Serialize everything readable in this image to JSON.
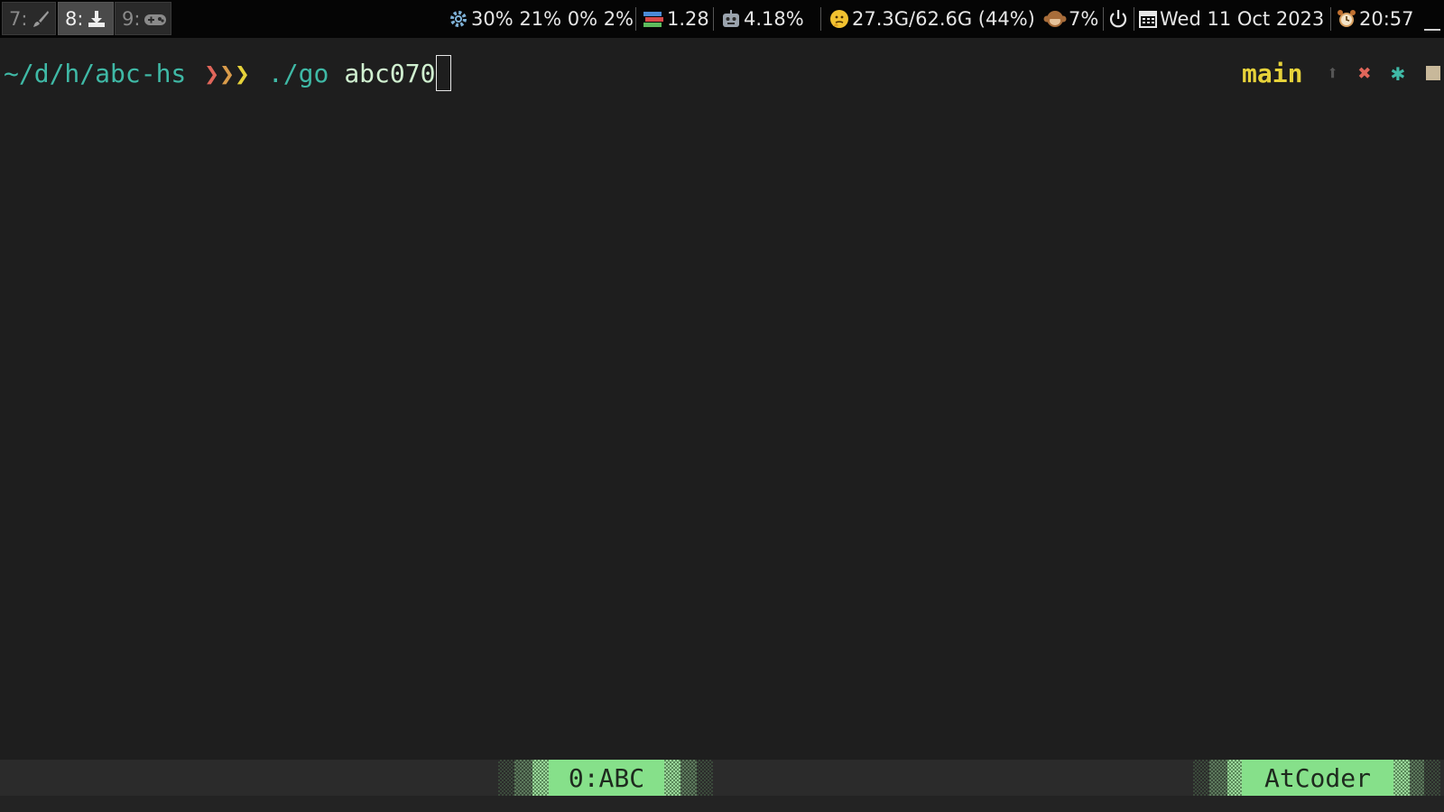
{
  "workspaces": [
    {
      "num": "7:",
      "icon": "paintbrush-icon",
      "active": false
    },
    {
      "num": "8:",
      "icon": "download-icon",
      "active": true
    },
    {
      "num": "9:",
      "icon": "gamepad-icon",
      "active": false
    }
  ],
  "status": {
    "cpu": "30% 21% 0% 2%",
    "load": "1.28",
    "gpu": "4.18%",
    "memory": "27.3G/62.6G (44%)",
    "volume": "7%",
    "date": "Wed 11 Oct 2023",
    "time": "20:57"
  },
  "terminal": {
    "cwd": "~/d/h/abc-hs",
    "arrows": [
      "❯",
      "❯",
      "❯"
    ],
    "command": "./go",
    "argument": "abc070",
    "branch": "main",
    "git_ahead": "⬆",
    "git_deleted": "✖",
    "git_modified": "✱"
  },
  "tmux": {
    "window_label": "0:ABC",
    "session_label": "AtCoder"
  },
  "colors": {
    "cwd": "#3fb9a6",
    "branch": "#e6d23a",
    "tab_bg": "#86e08a",
    "bar_bg": "#050505",
    "term_bg": "#1e1e1e"
  }
}
